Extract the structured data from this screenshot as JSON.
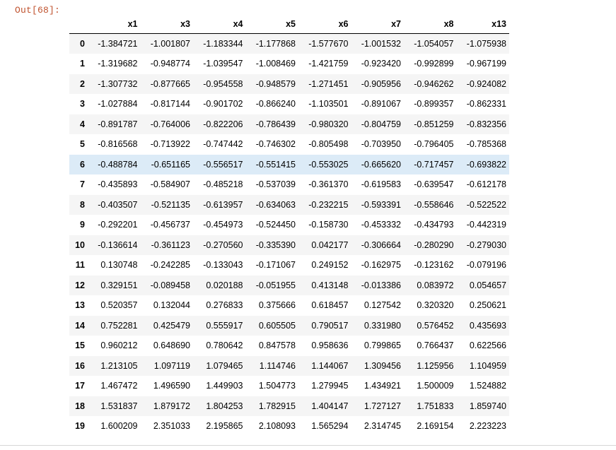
{
  "output": {
    "prompt": "Out[68]:"
  },
  "table": {
    "columns": [
      "x1",
      "x3",
      "x4",
      "x5",
      "x6",
      "x7",
      "x8",
      "x13"
    ],
    "highlighted_row": 6,
    "rows": [
      {
        "index": "0",
        "values": [
          "-1.384721",
          "-1.001807",
          "-1.183344",
          "-1.177868",
          "-1.577670",
          "-1.001532",
          "-1.054057",
          "-1.075938"
        ]
      },
      {
        "index": "1",
        "values": [
          "-1.319682",
          "-0.948774",
          "-1.039547",
          "-1.008469",
          "-1.421759",
          "-0.923420",
          "-0.992899",
          "-0.967199"
        ]
      },
      {
        "index": "2",
        "values": [
          "-1.307732",
          "-0.877665",
          "-0.954558",
          "-0.948579",
          "-1.271451",
          "-0.905956",
          "-0.946262",
          "-0.924082"
        ]
      },
      {
        "index": "3",
        "values": [
          "-1.027884",
          "-0.817144",
          "-0.901702",
          "-0.866240",
          "-1.103501",
          "-0.891067",
          "-0.899357",
          "-0.862331"
        ]
      },
      {
        "index": "4",
        "values": [
          "-0.891787",
          "-0.764006",
          "-0.822206",
          "-0.786439",
          "-0.980320",
          "-0.804759",
          "-0.851259",
          "-0.832356"
        ]
      },
      {
        "index": "5",
        "values": [
          "-0.816568",
          "-0.713922",
          "-0.747442",
          "-0.746302",
          "-0.805498",
          "-0.703950",
          "-0.796405",
          "-0.785368"
        ]
      },
      {
        "index": "6",
        "values": [
          "-0.488784",
          "-0.651165",
          "-0.556517",
          "-0.551415",
          "-0.553025",
          "-0.665620",
          "-0.717457",
          "-0.693822"
        ]
      },
      {
        "index": "7",
        "values": [
          "-0.435893",
          "-0.584907",
          "-0.485218",
          "-0.537039",
          "-0.361370",
          "-0.619583",
          "-0.639547",
          "-0.612178"
        ]
      },
      {
        "index": "8",
        "values": [
          "-0.403507",
          "-0.521135",
          "-0.613957",
          "-0.634063",
          "-0.232215",
          "-0.593391",
          "-0.558646",
          "-0.522522"
        ]
      },
      {
        "index": "9",
        "values": [
          "-0.292201",
          "-0.456737",
          "-0.454973",
          "-0.524450",
          "-0.158730",
          "-0.453332",
          "-0.434793",
          "-0.442319"
        ]
      },
      {
        "index": "10",
        "values": [
          "-0.136614",
          "-0.361123",
          "-0.270560",
          "-0.335390",
          "0.042177",
          "-0.306664",
          "-0.280290",
          "-0.279030"
        ]
      },
      {
        "index": "11",
        "values": [
          "0.130748",
          "-0.242285",
          "-0.133043",
          "-0.171067",
          "0.249152",
          "-0.162975",
          "-0.123162",
          "-0.079196"
        ]
      },
      {
        "index": "12",
        "values": [
          "0.329151",
          "-0.089458",
          "0.020188",
          "-0.051955",
          "0.413148",
          "-0.013386",
          "0.083972",
          "0.054657"
        ]
      },
      {
        "index": "13",
        "values": [
          "0.520357",
          "0.132044",
          "0.276833",
          "0.375666",
          "0.618457",
          "0.127542",
          "0.320320",
          "0.250621"
        ]
      },
      {
        "index": "14",
        "values": [
          "0.752281",
          "0.425479",
          "0.555917",
          "0.605505",
          "0.790517",
          "0.331980",
          "0.576452",
          "0.435693"
        ]
      },
      {
        "index": "15",
        "values": [
          "0.960212",
          "0.648690",
          "0.780642",
          "0.847578",
          "0.958636",
          "0.799865",
          "0.766437",
          "0.622566"
        ]
      },
      {
        "index": "16",
        "values": [
          "1.213105",
          "1.097119",
          "1.079465",
          "1.114746",
          "1.144067",
          "1.309456",
          "1.125956",
          "1.104959"
        ]
      },
      {
        "index": "17",
        "values": [
          "1.467472",
          "1.496590",
          "1.449903",
          "1.504773",
          "1.279945",
          "1.434921",
          "1.500009",
          "1.524882"
        ]
      },
      {
        "index": "18",
        "values": [
          "1.531837",
          "1.879172",
          "1.804253",
          "1.782915",
          "1.404147",
          "1.727127",
          "1.751833",
          "1.859740"
        ]
      },
      {
        "index": "19",
        "values": [
          "1.600209",
          "2.351033",
          "2.195865",
          "2.108093",
          "1.565294",
          "2.314745",
          "2.169154",
          "2.223223"
        ]
      }
    ]
  },
  "colors": {
    "prompt": "#c0532f",
    "row_stripe": "#f5f5f5",
    "row_highlight": "#dcebf7"
  }
}
